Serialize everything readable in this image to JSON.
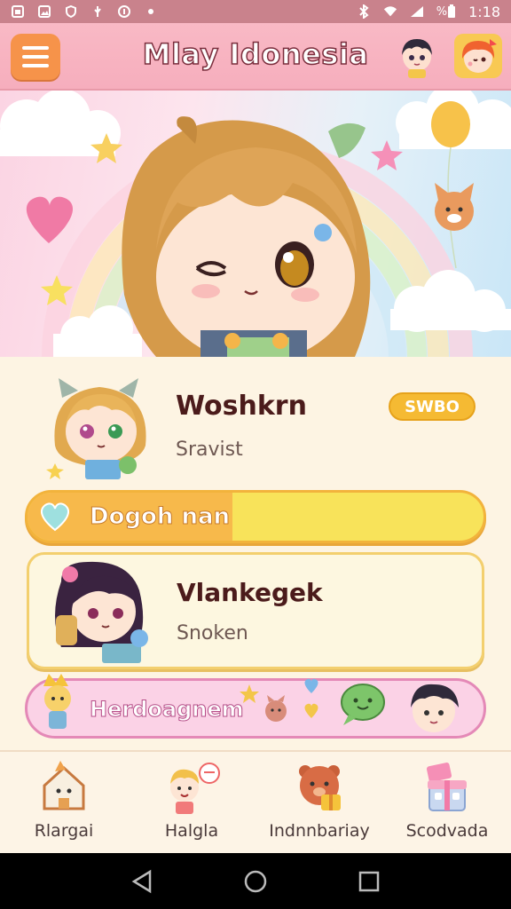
{
  "status_bar": {
    "time": "1:18",
    "left_icons": [
      "sim-icon",
      "image-icon",
      "shield-icon",
      "usb-icon",
      "info-icon",
      "dot-icon"
    ],
    "right_icons": [
      "bluetooth-icon",
      "wifi-icon",
      "signal-icon",
      "battery-icon"
    ],
    "battery_label": "%"
  },
  "header": {
    "title": "Mlay Idonesia",
    "menu_icon": "hamburger-menu-icon",
    "avatar_1": "chibi-boy-avatar",
    "avatar_2": "chibi-girl-avatar"
  },
  "hero": {
    "illustration": "winking-chibi-girl-banner"
  },
  "card_1": {
    "name": "Woshkrn",
    "subtitle": "Sravist",
    "badge": "SWBO"
  },
  "progress_bar_1": {
    "label": "Dogoh nan",
    "fill_fraction": 0.45
  },
  "card_2": {
    "name": "Vlankegek",
    "subtitle": "Snoken"
  },
  "banner_2": {
    "label": "Herdoagnem"
  },
  "bottom_nav": [
    {
      "label": "Rlargai",
      "icon": "house-character-icon"
    },
    {
      "label": "Halgla",
      "icon": "kid-speech-icon"
    },
    {
      "label": "Indnnbariay",
      "icon": "bear-gift-icon"
    },
    {
      "label": "Scodvada",
      "icon": "gift-box-icon"
    }
  ],
  "colors": {
    "header_bg": "#f6aebd",
    "menu_button": "#f6934a",
    "badge": "#f5ba33",
    "bar_1_track": "#f8e35a",
    "bar_2_bg": "#fbd2e6",
    "page_bg": "#fdf4e3"
  }
}
